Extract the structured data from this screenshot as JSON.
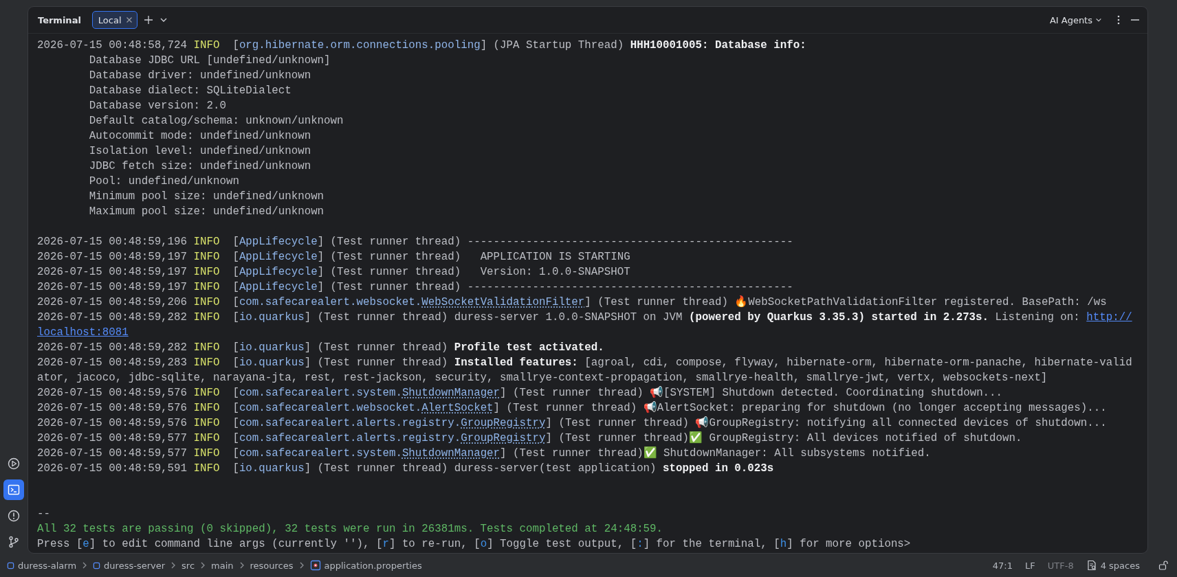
{
  "tool_strip": [
    {
      "kind": "services",
      "selected": false
    },
    {
      "kind": "terminal",
      "selected": true
    },
    {
      "kind": "problems",
      "selected": false
    },
    {
      "kind": "git",
      "selected": false
    }
  ],
  "terminal": {
    "title": "Terminal",
    "tabs": [
      {
        "label": "Local",
        "selected": true
      }
    ],
    "agents": "AI Agents",
    "lines": [
      {
        "kind": "log",
        "segments": [
          {
            "kind": "time",
            "text": "2026-07-15 00:48:58,724"
          },
          {
            "kind": "level",
            "text": "INFO"
          },
          {
            "kind": "text",
            "text": "["
          },
          {
            "kind": "logger",
            "text": "org.hibernate.orm.connections.pooling"
          },
          {
            "kind": "text",
            "text": "] (JPA Startup Thread) "
          },
          {
            "kind": "bold",
            "text": "HHH10001005: Database info:"
          }
        ]
      },
      {
        "kind": "detail",
        "segments": [
          {
            "kind": "text",
            "text": "Database JDBC URL [undefined/unknown]"
          }
        ]
      },
      {
        "kind": "detail",
        "segments": [
          {
            "kind": "text",
            "text": "Database driver: undefined/unknown"
          }
        ]
      },
      {
        "kind": "detail",
        "segments": [
          {
            "kind": "text",
            "text": "Database dialect: SQLiteDialect"
          }
        ]
      },
      {
        "kind": "detail",
        "segments": [
          {
            "kind": "text",
            "text": "Database version: 2.0"
          }
        ]
      },
      {
        "kind": "detail",
        "segments": [
          {
            "kind": "text",
            "text": "Default catalog/schema: unknown/unknown"
          }
        ]
      },
      {
        "kind": "detail",
        "segments": [
          {
            "kind": "text",
            "text": "Autocommit mode: undefined/unknown"
          }
        ]
      },
      {
        "kind": "detail",
        "segments": [
          {
            "kind": "text",
            "text": "Isolation level: undefined/unknown"
          }
        ]
      },
      {
        "kind": "detail",
        "segments": [
          {
            "kind": "text",
            "text": "JDBC fetch size: undefined/unknown"
          }
        ]
      },
      {
        "kind": "detail",
        "segments": [
          {
            "kind": "text",
            "text": "Pool: undefined/unknown"
          }
        ]
      },
      {
        "kind": "detail",
        "segments": [
          {
            "kind": "text",
            "text": "Minimum pool size: undefined/unknown"
          }
        ]
      },
      {
        "kind": "detail",
        "segments": [
          {
            "kind": "text",
            "text": "Maximum pool size: undefined/unknown"
          }
        ]
      },
      {
        "kind": "blank"
      },
      {
        "kind": "log",
        "segments": [
          {
            "kind": "time",
            "text": "2026-07-15 00:48:59,196"
          },
          {
            "kind": "level",
            "text": "INFO"
          },
          {
            "kind": "text",
            "text": "["
          },
          {
            "kind": "logger",
            "text": "AppLifecycle"
          },
          {
            "kind": "text",
            "text": "] (Test runner thread) --------------------------------------------------"
          }
        ]
      },
      {
        "kind": "log",
        "segments": [
          {
            "kind": "time",
            "text": "2026-07-15 00:48:59,197"
          },
          {
            "kind": "level",
            "text": "INFO"
          },
          {
            "kind": "text",
            "text": "["
          },
          {
            "kind": "logger",
            "text": "AppLifecycle"
          },
          {
            "kind": "text",
            "text": "] (Test runner thread)   APPLICATION IS STARTING"
          }
        ]
      },
      {
        "kind": "log",
        "segments": [
          {
            "kind": "time",
            "text": "2026-07-15 00:48:59,197"
          },
          {
            "kind": "level",
            "text": "INFO"
          },
          {
            "kind": "text",
            "text": "["
          },
          {
            "kind": "logger",
            "text": "AppLifecycle"
          },
          {
            "kind": "text",
            "text": "] (Test runner thread)   Version: 1.0.0-SNAPSHOT"
          }
        ]
      },
      {
        "kind": "log",
        "segments": [
          {
            "kind": "time",
            "text": "2026-07-15 00:48:59,197"
          },
          {
            "kind": "level",
            "text": "INFO"
          },
          {
            "kind": "text",
            "text": "["
          },
          {
            "kind": "logger",
            "text": "AppLifecycle"
          },
          {
            "kind": "text",
            "text": "] (Test runner thread) --------------------------------------------------"
          }
        ]
      },
      {
        "kind": "log",
        "segments": [
          {
            "kind": "time",
            "text": "2026-07-15 00:48:59,206"
          },
          {
            "kind": "level",
            "text": "INFO"
          },
          {
            "kind": "text",
            "text": "["
          },
          {
            "kind": "logger",
            "text": "com.safecarealert.websocket."
          },
          {
            "kind": "logger_class",
            "text": "WebSocketValidationFilter"
          },
          {
            "kind": "text",
            "text": "] (Test runner thread) 🔥WebSocketPathValidationFilter registered. BasePath: /ws"
          }
        ]
      },
      {
        "kind": "log",
        "segments": [
          {
            "kind": "time",
            "text": "2026-07-15 00:48:59,282"
          },
          {
            "kind": "level",
            "text": "INFO"
          },
          {
            "kind": "text",
            "text": "["
          },
          {
            "kind": "logger",
            "text": "io.quarkus"
          },
          {
            "kind": "text",
            "text": "] (Test runner thread) duress-server 1.0.0-SNAPSHOT on JVM "
          },
          {
            "kind": "bold",
            "text": "(powered by Quarkus 3.35.3) started in 2.273s."
          },
          {
            "kind": "text",
            "text": " Listening on: "
          },
          {
            "kind": "link",
            "text": "http://"
          }
        ]
      },
      {
        "kind": "wrap",
        "segments": [
          {
            "kind": "link",
            "text": "localhost:8081"
          }
        ]
      },
      {
        "kind": "log",
        "segments": [
          {
            "kind": "time",
            "text": "2026-07-15 00:48:59,282"
          },
          {
            "kind": "level",
            "text": "INFO"
          },
          {
            "kind": "text",
            "text": "["
          },
          {
            "kind": "logger",
            "text": "io.quarkus"
          },
          {
            "kind": "text",
            "text": "] (Test runner thread) "
          },
          {
            "kind": "bold",
            "text": "Profile test activated."
          }
        ]
      },
      {
        "kind": "log",
        "segments": [
          {
            "kind": "time",
            "text": "2026-07-15 00:48:59,283"
          },
          {
            "kind": "level",
            "text": "INFO"
          },
          {
            "kind": "text",
            "text": "["
          },
          {
            "kind": "logger",
            "text": "io.quarkus"
          },
          {
            "kind": "text",
            "text": "] (Test runner thread) "
          },
          {
            "kind": "bold",
            "text": "Installed features:"
          },
          {
            "kind": "text",
            "text": " [agroal, cdi, compose, flyway, hibernate-orm, hibernate-orm-panache, hibernate-valid"
          }
        ]
      },
      {
        "kind": "wrap",
        "segments": [
          {
            "kind": "text",
            "text": "ator, jacoco, jdbc-sqlite, narayana-jta, rest, rest-jackson, security, smallrye-context-propagation, smallrye-health, smallrye-jwt, vertx, websockets-next]"
          }
        ]
      },
      {
        "kind": "log",
        "segments": [
          {
            "kind": "time",
            "text": "2026-07-15 00:48:59,576"
          },
          {
            "kind": "level",
            "text": "INFO"
          },
          {
            "kind": "text",
            "text": "["
          },
          {
            "kind": "logger",
            "text": "com.safecarealert.system."
          },
          {
            "kind": "logger_class",
            "text": "ShutdownManager"
          },
          {
            "kind": "text",
            "text": "] (Test runner thread) 📢[SYSTEM] Shutdown detected. Coordinating shutdown..."
          }
        ]
      },
      {
        "kind": "log",
        "segments": [
          {
            "kind": "time",
            "text": "2026-07-15 00:48:59,576"
          },
          {
            "kind": "level",
            "text": "INFO"
          },
          {
            "kind": "text",
            "text": "["
          },
          {
            "kind": "logger",
            "text": "com.safecarealert.websocket."
          },
          {
            "kind": "logger_class",
            "text": "AlertSocket"
          },
          {
            "kind": "text",
            "text": "] (Test runner thread) 📢AlertSocket: preparing for shutdown (no longer accepting messages)..."
          }
        ]
      },
      {
        "kind": "log",
        "segments": [
          {
            "kind": "time",
            "text": "2026-07-15 00:48:59,576"
          },
          {
            "kind": "level",
            "text": "INFO"
          },
          {
            "kind": "text",
            "text": "["
          },
          {
            "kind": "logger",
            "text": "com.safecarealert.alerts.registry."
          },
          {
            "kind": "logger_class",
            "text": "GroupRegistry"
          },
          {
            "kind": "text",
            "text": "] (Test runner thread) 📢GroupRegistry: notifying all connected devices of shutdown..."
          }
        ]
      },
      {
        "kind": "log",
        "segments": [
          {
            "kind": "time",
            "text": "2026-07-15 00:48:59,577"
          },
          {
            "kind": "level",
            "text": "INFO"
          },
          {
            "kind": "text",
            "text": "["
          },
          {
            "kind": "logger",
            "text": "com.safecarealert.alerts.registry."
          },
          {
            "kind": "logger_class",
            "text": "GroupRegistry"
          },
          {
            "kind": "text",
            "text": "] (Test runner thread)✅ GroupRegistry: All devices notified of shutdown."
          }
        ]
      },
      {
        "kind": "log",
        "segments": [
          {
            "kind": "time",
            "text": "2026-07-15 00:48:59,577"
          },
          {
            "kind": "level",
            "text": "INFO"
          },
          {
            "kind": "text",
            "text": "["
          },
          {
            "kind": "logger",
            "text": "com.safecarealert.system."
          },
          {
            "kind": "logger_class",
            "text": "ShutdownManager"
          },
          {
            "kind": "text",
            "text": "] (Test runner thread)✅ ShutdownManager: All subsystems notified."
          }
        ]
      },
      {
        "kind": "log",
        "segments": [
          {
            "kind": "time",
            "text": "2026-07-15 00:48:59,591"
          },
          {
            "kind": "level",
            "text": "INFO"
          },
          {
            "kind": "text",
            "text": "["
          },
          {
            "kind": "logger",
            "text": "io.quarkus"
          },
          {
            "kind": "text",
            "text": "] (Test runner thread) duress-server(test application) "
          },
          {
            "kind": "bold",
            "text": "stopped in 0.023s"
          }
        ]
      },
      {
        "kind": "blank"
      },
      {
        "kind": "blank"
      },
      {
        "kind": "plain",
        "segments": [
          {
            "kind": "text",
            "text": "--"
          }
        ]
      },
      {
        "kind": "plain",
        "segments": [
          {
            "kind": "pass",
            "text": "All 32 tests are passing (0 skipped), 32 tests were run in 26381ms. Tests completed at 24:48:59."
          }
        ]
      },
      {
        "kind": "plain",
        "segments": [
          {
            "kind": "text",
            "text": "Press ["
          },
          {
            "kind": "key",
            "text": "e"
          },
          {
            "kind": "text",
            "text": "] to edit command line args (currently ''), ["
          },
          {
            "kind": "key",
            "text": "r"
          },
          {
            "kind": "text",
            "text": "] to re-run, ["
          },
          {
            "kind": "key",
            "text": "o"
          },
          {
            "kind": "text",
            "text": "] Toggle test output, ["
          },
          {
            "kind": "key",
            "text": ":"
          },
          {
            "kind": "text",
            "text": "] for the terminal, ["
          },
          {
            "kind": "key",
            "text": "h"
          },
          {
            "kind": "text",
            "text": "] for more options>"
          }
        ]
      }
    ]
  },
  "status_bar": {
    "breadcrumbs": [
      {
        "kind": "module",
        "label": "duress-alarm"
      },
      {
        "kind": "module",
        "label": "duress-server"
      },
      {
        "kind": "folder",
        "label": "src"
      },
      {
        "kind": "folder",
        "label": "main"
      },
      {
        "kind": "folder",
        "label": "resources"
      },
      {
        "kind": "file",
        "label": "application.properties"
      }
    ],
    "position": "47:1",
    "line_separator": "LF",
    "encoding": "UTF-8",
    "indent": "4 spaces"
  }
}
